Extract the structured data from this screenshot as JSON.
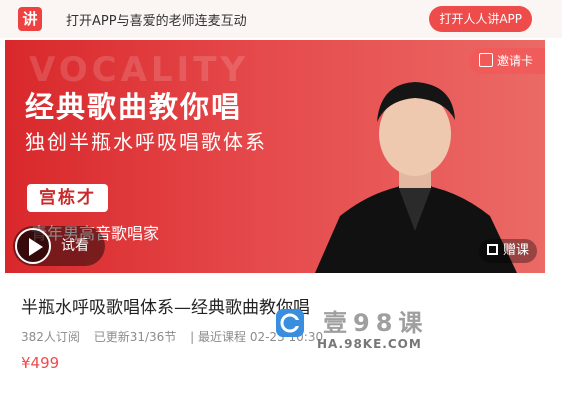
{
  "topbar": {
    "logo_text": "讲",
    "promo_text": "打开APP与喜爱的老师连麦互动",
    "open_app_label": "打开人人讲APP"
  },
  "banner": {
    "watermark_text": "VOCALITY",
    "headline": "经典歌曲教你唱",
    "subheadline": "独创半瓶水呼吸唱歌体系",
    "teacher_name": "宫栋才",
    "teacher_title": "青年男高音歌唱家",
    "invite_label": "邀请卡",
    "trial_label": "试看",
    "gift_label": "赠课",
    "colors": {
      "banner_start": "#d9282b",
      "banner_end": "#eb6a66"
    }
  },
  "course": {
    "title": "半瓶水呼吸歌唱体系—经典歌曲教你唱",
    "subscribers": "382人订阅",
    "updated": "已更新31/36节",
    "latest": "| 最近课程 02-23 10:30",
    "price": "¥499"
  },
  "site_watermark": {
    "chinese": "壹98课",
    "url": "HA.98KE.COM"
  },
  "colors": {
    "accent": "#ee4b4b",
    "text_muted": "#8c8c8c"
  },
  "icons": [
    "logo-icon",
    "invite-card-icon",
    "play-icon",
    "gift-icon",
    "watermark-badge-icon"
  ]
}
